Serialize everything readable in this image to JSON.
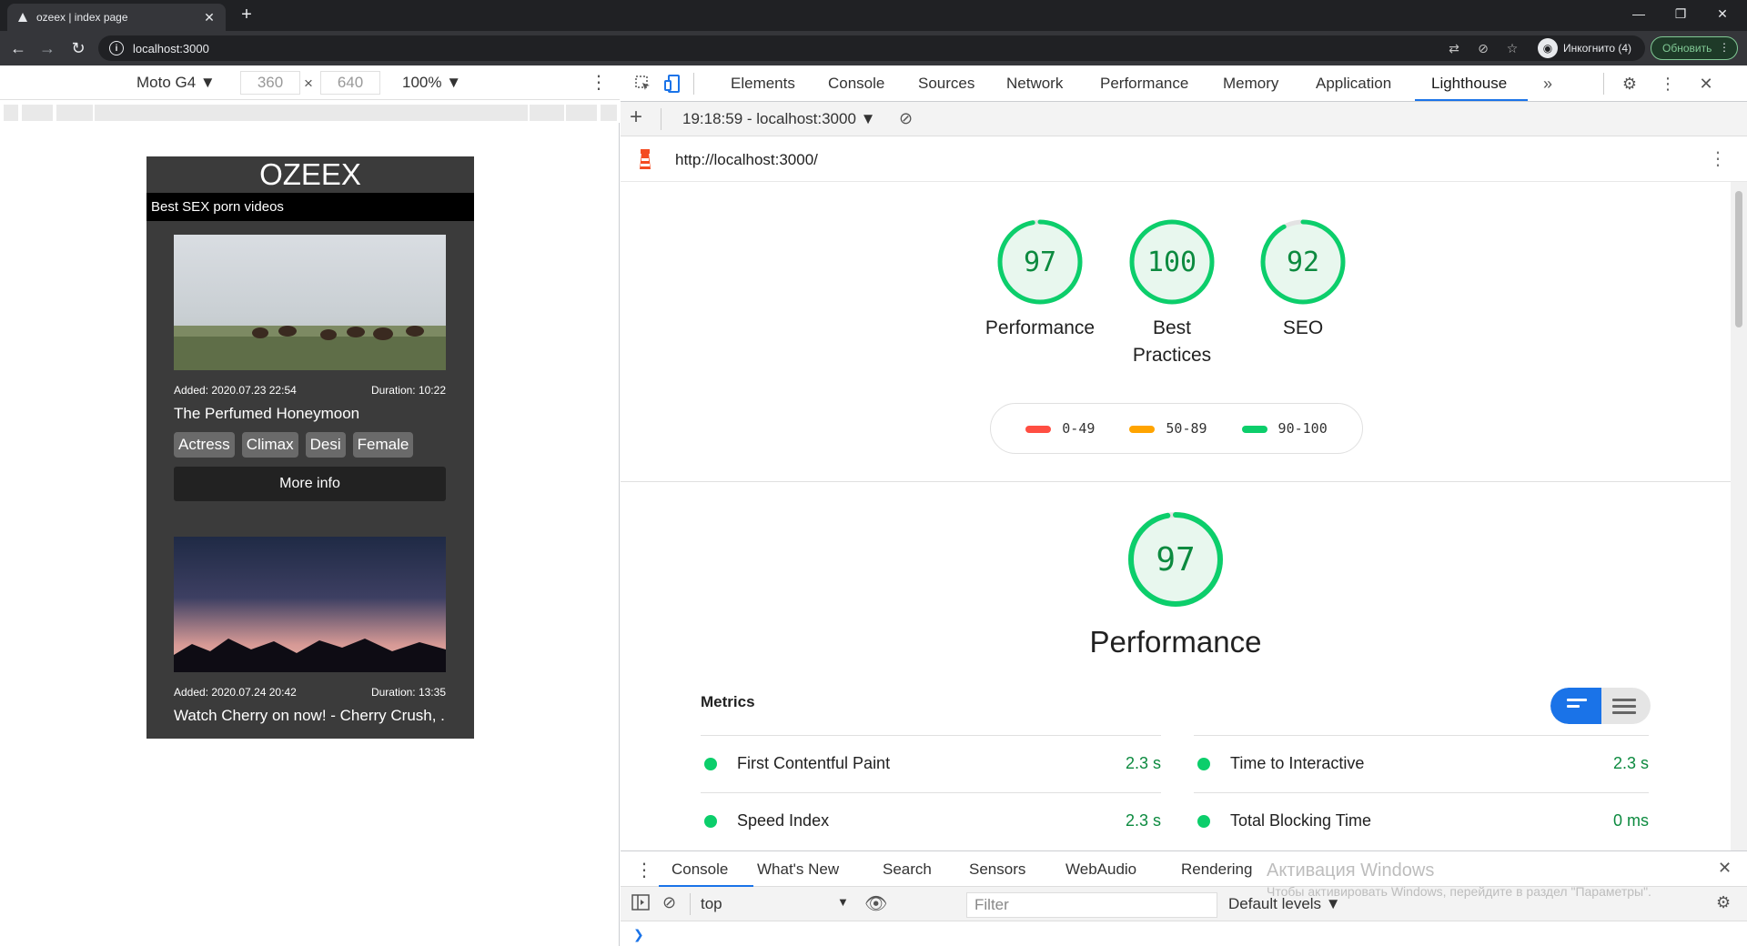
{
  "browser": {
    "tab_title": "ozeex | index page",
    "address": "localhost:3000",
    "incognito_label": "Инкогнито (4)",
    "update_label": "Обновить"
  },
  "device_toolbar": {
    "device": "Moto G4",
    "width": "360",
    "height": "640",
    "zoom": "100%"
  },
  "site": {
    "brand": "OZEEX",
    "tagline": "Best SEX porn videos",
    "videos": [
      {
        "added": "Added: 2020.07.23 22:54",
        "duration": "Duration: 10:22",
        "title": "The Perfumed Honeymoon",
        "tags": [
          "Actress",
          "Climax",
          "Desi",
          "Female"
        ],
        "more": "More info"
      },
      {
        "added": "Added: 2020.07.24 20:42",
        "duration": "Duration: 13:35",
        "title": "Watch Cherry on now! - Cherry Crush, ..."
      }
    ]
  },
  "devtools": {
    "tabs": [
      "Elements",
      "Console",
      "Sources",
      "Network",
      "Performance",
      "Memory",
      "Application",
      "Lighthouse"
    ],
    "active_tab": "Lighthouse",
    "report_selector": "19:18:59 - localhost:3000",
    "report_url": "http://localhost:3000/"
  },
  "lighthouse": {
    "scores": [
      {
        "value": 97,
        "label": "Performance"
      },
      {
        "value": 100,
        "label": "Best Practices"
      },
      {
        "value": 92,
        "label": "SEO"
      }
    ],
    "legend": [
      "0-49",
      "50-89",
      "90-100"
    ],
    "performance_score": 97,
    "performance_title": "Performance",
    "metrics_heading": "Metrics",
    "metrics": [
      {
        "name": "First Contentful Paint",
        "value": "2.3 s"
      },
      {
        "name": "Time to Interactive",
        "value": "2.3 s"
      },
      {
        "name": "Speed Index",
        "value": "2.3 s"
      },
      {
        "name": "Total Blocking Time",
        "value": "0 ms"
      }
    ],
    "colors": {
      "pass": "#0cce6b",
      "average": "#ffa400",
      "fail": "#ff4e42"
    }
  },
  "drawer": {
    "tabs": [
      "Console",
      "What's New",
      "Search",
      "Sensors",
      "WebAudio",
      "Rendering"
    ],
    "context": "top",
    "filter_placeholder": "Filter",
    "levels": "Default levels"
  },
  "watermark": {
    "title": "Активация Windows",
    "subtitle": "Чтобы активировать Windows, перейдите в раздел \"Параметры\"."
  }
}
